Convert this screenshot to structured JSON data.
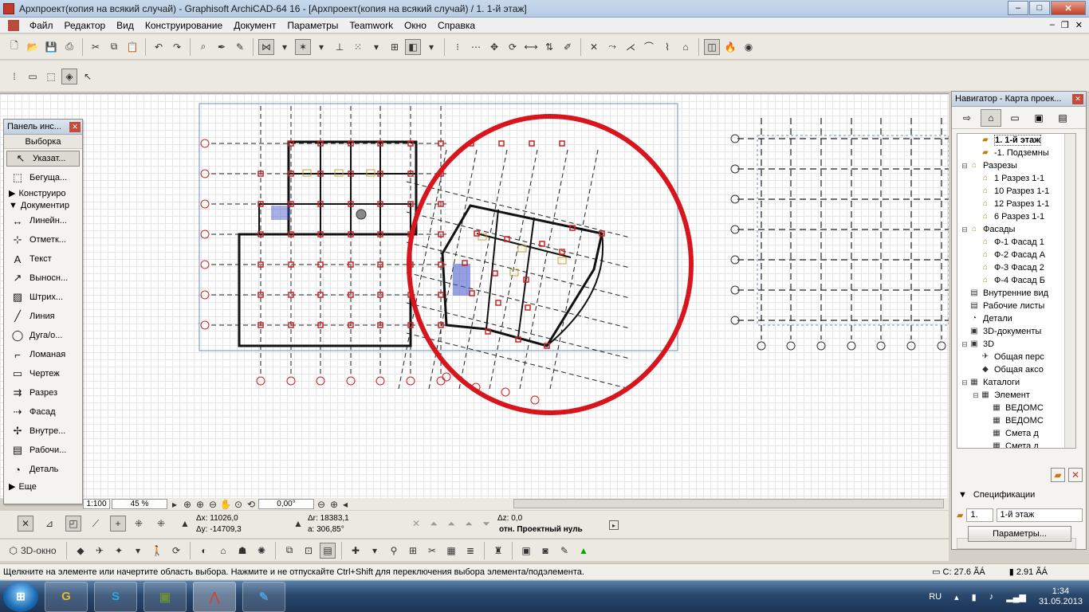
{
  "window": {
    "title": "Архпроект(копия на всякий случай) - Graphisoft ArchiCAD-64 16 - [Архпроект(копия на всякий случай) / 1. 1-й этаж]",
    "controls": [
      "–",
      "□",
      "✕"
    ]
  },
  "menu": [
    "Файл",
    "Редактор",
    "Вид",
    "Конструирование",
    "Документ",
    "Параметры",
    "Teamwork",
    "Окно",
    "Справка"
  ],
  "toolbox": {
    "title": "Панель инс...",
    "section": "Выборка",
    "items": [
      {
        "label": "Указат...",
        "icon": "arrow-pointer-icon"
      },
      {
        "label": "Бегуща...",
        "icon": "marquee-icon"
      }
    ],
    "group_construct": "Конструиро",
    "group_document": "Документир",
    "doc_items": [
      {
        "label": "Линейн...",
        "icon": "linear-dimension-icon"
      },
      {
        "label": "Отметк...",
        "icon": "level-dimension-icon"
      },
      {
        "label": "Текст",
        "icon": "text-icon"
      },
      {
        "label": "Выносн...",
        "icon": "label-icon"
      },
      {
        "label": "Штрих...",
        "icon": "fill-icon"
      },
      {
        "label": "Линия",
        "icon": "line-icon"
      },
      {
        "label": "Дуга/о...",
        "icon": "arc-icon"
      },
      {
        "label": "Ломаная",
        "icon": "polyline-icon"
      },
      {
        "label": "Чертеж",
        "icon": "drawing-icon"
      },
      {
        "label": "Разрез",
        "icon": "section-icon"
      },
      {
        "label": "Фасад",
        "icon": "elevation-icon"
      },
      {
        "label": "Внутре...",
        "icon": "interior-elevation-icon"
      },
      {
        "label": "Рабочи...",
        "icon": "worksheet-icon"
      },
      {
        "label": "Деталь",
        "icon": "detail-icon"
      }
    ],
    "more": "Еще"
  },
  "navigator": {
    "title": "Навигатор - Карта проек...",
    "tree": [
      {
        "label": "1. 1-й этаж",
        "depth": 2,
        "icon": "story-icon",
        "bold": true
      },
      {
        "label": "-1. Подземны",
        "depth": 2,
        "icon": "story-icon"
      },
      {
        "label": "Разрезы",
        "depth": 1,
        "icon": "section-folder-icon",
        "toggle": "⊟"
      },
      {
        "label": "1 Разрез 1-1",
        "depth": 2,
        "icon": "section-icon"
      },
      {
        "label": "10 Разрез 1-1",
        "depth": 2,
        "icon": "section-icon"
      },
      {
        "label": "12 Разрез 1-1",
        "depth": 2,
        "icon": "section-icon"
      },
      {
        "label": "6 Разрез 1-1",
        "depth": 2,
        "icon": "section-icon"
      },
      {
        "label": "Фасады",
        "depth": 1,
        "icon": "elevation-folder-icon",
        "toggle": "⊟"
      },
      {
        "label": "Ф-1 Фасад 1",
        "depth": 2,
        "icon": "elevation-icon"
      },
      {
        "label": "Ф-2 Фасад А",
        "depth": 2,
        "icon": "elevation-icon"
      },
      {
        "label": "Ф-3 Фасад 2",
        "depth": 2,
        "icon": "elevation-icon"
      },
      {
        "label": "Ф-4 Фасад Б",
        "depth": 2,
        "icon": "elevation-icon"
      },
      {
        "label": "Внутренние вид",
        "depth": 1,
        "icon": "interior-icon"
      },
      {
        "label": "Рабочие листы",
        "depth": 1,
        "icon": "worksheet-icon"
      },
      {
        "label": "Детали",
        "depth": 1,
        "icon": "detail-icon"
      },
      {
        "label": "3D-документы",
        "depth": 1,
        "icon": "3d-doc-icon"
      },
      {
        "label": "3D",
        "depth": 1,
        "icon": "3d-icon",
        "toggle": "⊟"
      },
      {
        "label": "Общая перс",
        "depth": 2,
        "icon": "perspective-icon"
      },
      {
        "label": "Общая аксо",
        "depth": 2,
        "icon": "axonometry-icon"
      },
      {
        "label": "Каталоги",
        "depth": 1,
        "icon": "catalog-icon",
        "toggle": "⊟"
      },
      {
        "label": "Элемент",
        "depth": 2,
        "icon": "element-icon",
        "toggle": "⊟"
      },
      {
        "label": "ВЕДОМС",
        "depth": 3,
        "icon": "schedule-icon"
      },
      {
        "label": "ВЕДОМС",
        "depth": 3,
        "icon": "schedule-icon"
      },
      {
        "label": "Смета д",
        "depth": 3,
        "icon": "schedule-icon"
      },
      {
        "label": "Смета д",
        "depth": 3,
        "icon": "schedule-icon"
      }
    ],
    "specs_label": "Спецификации",
    "story_num": "1.",
    "story_name": "1-й этаж",
    "params_button": "Параметры..."
  },
  "zoom": {
    "scale": "1:100",
    "value": "45 %",
    "angle": "0,00°"
  },
  "coords": {
    "dx_label": "Δx:",
    "dx": "11026,0",
    "dy_label": "Δy:",
    "dy": "-14709,3",
    "dr_label": "Δr:",
    "dr": "18383,1",
    "a_label": "a:",
    "a": "306,85°",
    "dz_label": "Δz:",
    "dz": "0,0",
    "ref": "отн. Проектный нуль"
  },
  "bottom_toolbar": {
    "view3d_label": "3D-окно"
  },
  "status": {
    "hint": "Щелкните на элементе или начертите область выбора. Нажмите и не отпускайте Ctrl+Shift для переключения выбора элемента/подэлемента.",
    "c_label": "C: 27.6 ÃÁ",
    "mem_label": "2.91 ÃÁ"
  },
  "taskbar": {
    "lang": "RU",
    "time": "1:34",
    "date": "31.05.2013",
    "apps": [
      {
        "label": "G",
        "icon": "chrome-icon"
      },
      {
        "label": "S",
        "icon": "skype-icon"
      },
      {
        "label": "▣",
        "icon": "minecraft-icon"
      },
      {
        "label": "⋀",
        "icon": "archicad-icon"
      },
      {
        "label": "✎",
        "icon": "paint-icon"
      }
    ]
  },
  "colors": {
    "grid_marker": "#cc2222",
    "annotation_circle": "#d8141c",
    "wall": "#111111",
    "axis": "#222222",
    "furniture": "#c8a030",
    "selection": "#6b8cc9"
  }
}
